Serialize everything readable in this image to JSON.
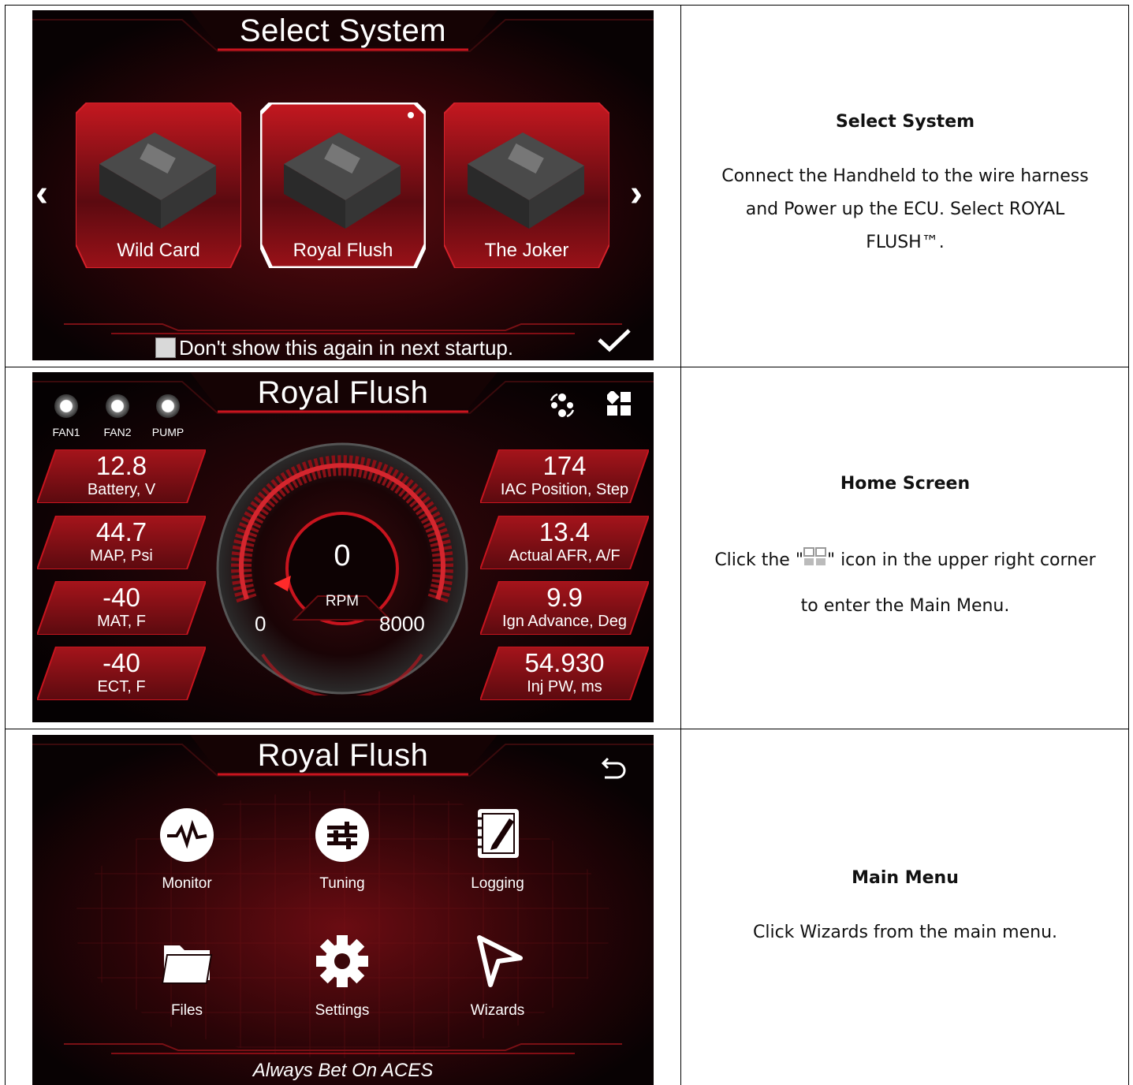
{
  "rows": [
    {
      "screen": {
        "title": "Select System",
        "cards": [
          "Wild Card",
          "Royal Flush",
          "The Joker"
        ],
        "selected_card": "Royal Flush",
        "prev_arrow": "‹",
        "next_arrow": "›",
        "checkbox_label": "Don't show this again in next startup.",
        "checkbox_checked": false
      },
      "caption": {
        "title": "Select System",
        "body": "Connect the Handheld to the wire harness and Power up the ECU. Select ROYAL FLUSH™."
      }
    },
    {
      "screen": {
        "title": "Royal Flush",
        "indicators": [
          "FAN1",
          "FAN2",
          "PUMP"
        ],
        "left_readouts": [
          {
            "value": "12.8",
            "label": "Battery, V"
          },
          {
            "value": "44.7",
            "label": "MAP, Psi"
          },
          {
            "value": "-40",
            "label": "MAT, F"
          },
          {
            "value": "-40",
            "label": "ECT, F"
          }
        ],
        "right_readouts": [
          {
            "value": "174",
            "label": "IAC Position, Step"
          },
          {
            "value": "13.4",
            "label": "Actual AFR, A/F"
          },
          {
            "value": "9.9",
            "label": "Ign Advance, Deg"
          },
          {
            "value": "54.930",
            "label": "Inj PW, ms"
          }
        ],
        "gauge": {
          "value": "0",
          "unit": "RPM",
          "min": "0",
          "max": "8000"
        },
        "icons": [
          "sync-icon",
          "menu-grid-icon"
        ]
      },
      "caption": {
        "title": "Home Screen",
        "body_before": "Click the \"",
        "body_after": "\" icon in the upper right corner",
        "body_line2": "to enter the Main Menu."
      }
    },
    {
      "screen": {
        "title": "Royal Flush",
        "menu": [
          "Monitor",
          "Tuning",
          "Logging",
          "Files",
          "Settings",
          "Wizards"
        ],
        "tagline": "Always Bet On ACES"
      },
      "caption": {
        "title": "Main Menu",
        "body": "Click Wizards from the main menu."
      }
    }
  ],
  "colors": {
    "accent": "#c8141e",
    "dark_red": "#5a0a0e",
    "panel": "#0a0304"
  }
}
